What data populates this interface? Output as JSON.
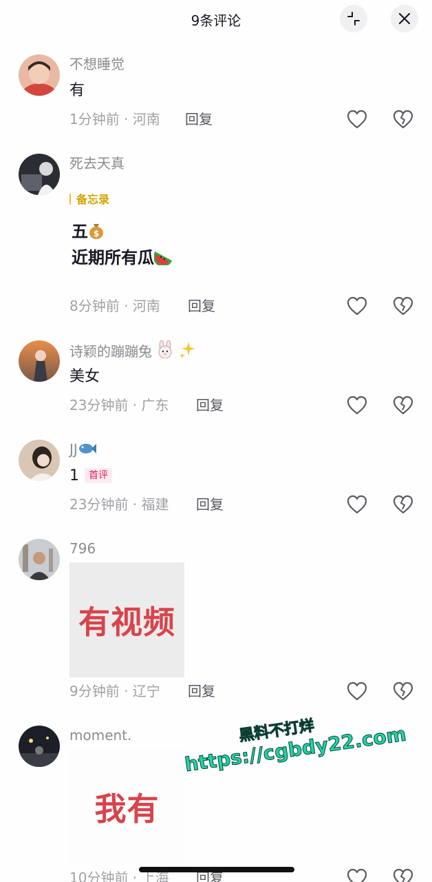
{
  "header": {
    "title": "9条评论"
  },
  "comments": [
    {
      "username": "不想睡觉",
      "text": "有",
      "meta": "1分钟前 · 河南",
      "reply": "回复"
    },
    {
      "username": "死去天真",
      "memo": "备忘录",
      "line1": "五",
      "line2": "近期所有瓜",
      "meta": "8分钟前 · 河南",
      "reply": "回复"
    },
    {
      "username": "诗颖的蹦蹦兔",
      "text": "美女",
      "meta": "23分钟前 · 广东",
      "reply": "回复"
    },
    {
      "username": "JJ",
      "text": "1",
      "badge": "首评",
      "meta": "23分钟前 · 福建",
      "reply": "回复"
    },
    {
      "username": "796",
      "sticker_text": "有视频",
      "meta": "9分钟前 · 辽宁",
      "reply": "回复"
    },
    {
      "username": "moment.",
      "sticker_text": "我有",
      "meta": "10分钟前 · 上海",
      "reply": "回复"
    }
  ],
  "watermark": {
    "line1": "黑料不打烊",
    "line2": "https://cgbdy22.com"
  },
  "icons": {
    "like": "heart-outline-icon",
    "dislike": "broken-heart-icon",
    "collapse": "collapse-icon",
    "close": "close-icon"
  }
}
